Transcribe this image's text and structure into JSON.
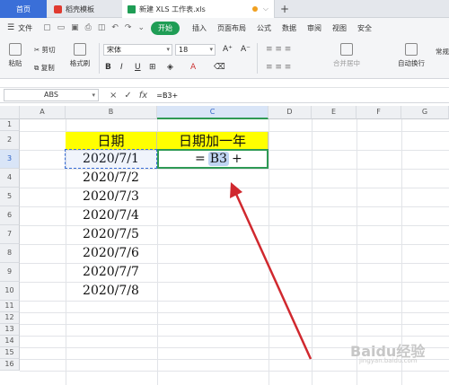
{
  "tabs": {
    "home": "首页",
    "template": "稻壳模板",
    "file": "新建 XLS 工作表.xls",
    "add": "+"
  },
  "menu": {
    "file": "文件",
    "start": "开始",
    "items": [
      "插入",
      "页面布局",
      "公式",
      "数据",
      "审阅",
      "视图",
      "安全"
    ]
  },
  "ribbon": {
    "paste": "粘贴",
    "cut": "剪切",
    "copy": "复制",
    "format_painter": "格式刷",
    "font_name": "宋体",
    "font_size": "18",
    "bold": "B",
    "italic": "I",
    "underline": "U",
    "merge": "合并居中",
    "wrap": "自动换行",
    "normal": "常规"
  },
  "formula_bar": {
    "name_box": "ABS",
    "cancel": "×",
    "confirm": "✓",
    "fx": "fx",
    "formula": "=B3+"
  },
  "columns": [
    "A",
    "B",
    "C",
    "D",
    "E",
    "F",
    "G"
  ],
  "rows": [
    "1",
    "2",
    "3",
    "4",
    "5",
    "6",
    "7",
    "8",
    "9",
    "10",
    "11",
    "12",
    "13",
    "14",
    "15",
    "16"
  ],
  "cells": {
    "b2": "日期",
    "c2": "日期加一年",
    "dates": [
      "2020/7/1",
      "2020/7/2",
      "2020/7/3",
      "2020/7/4",
      "2020/7/5",
      "2020/7/6",
      "2020/7/7",
      "2020/7/8"
    ],
    "c3_prefix": "=",
    "c3_ref": "B3",
    "c3_suffix": "+"
  },
  "watermark": "Baidu经验",
  "watermark_sub": "jingyan.baidu.com",
  "colors": {
    "header_yellow": "#ffff00",
    "accent_green": "#2f9a55",
    "arrow_red": "#d0282e",
    "tab_blue": "#3a6fd8"
  }
}
